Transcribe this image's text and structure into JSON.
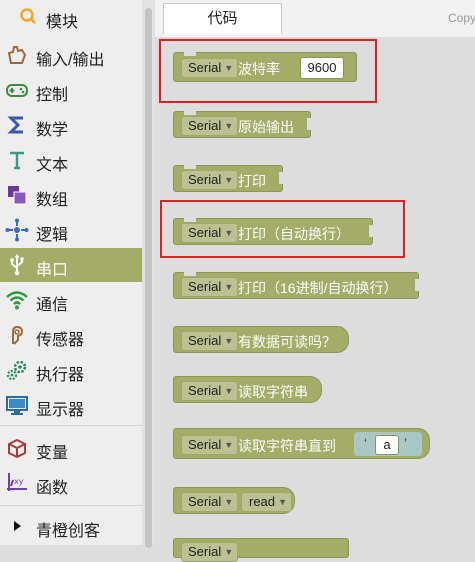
{
  "sidebar": {
    "header": "模块",
    "items": [
      {
        "label": "输入/输出",
        "icon": "hand-icon"
      },
      {
        "label": "控制",
        "icon": "gamepad-icon"
      },
      {
        "label": "数学",
        "icon": "sigma-icon"
      },
      {
        "label": "文本",
        "icon": "text-icon"
      },
      {
        "label": "数组",
        "icon": "array-icon"
      },
      {
        "label": "逻辑",
        "icon": "logic-icon"
      },
      {
        "label": "串口",
        "icon": "usb-icon"
      },
      {
        "label": "通信",
        "icon": "wifi-icon"
      },
      {
        "label": "传感器",
        "icon": "sensor-icon"
      },
      {
        "label": "执行器",
        "icon": "gears-icon"
      },
      {
        "label": "显示器",
        "icon": "monitor-icon"
      },
      {
        "label": "变量",
        "icon": "cube-icon"
      },
      {
        "label": "函数",
        "icon": "function-icon"
      },
      {
        "label": "青橙创客",
        "icon": "triangle-right-icon"
      }
    ],
    "active_index": 6
  },
  "tabs": {
    "code": "代码",
    "copy": "Copy"
  },
  "blocks": {
    "serial_label": "Serial",
    "begin_text": "波特率",
    "baud": "9600",
    "write_text": "原始输出",
    "print_text": "打印",
    "println_text": "打印（自动换行）",
    "print_hex_text": "打印（16进制/自动换行）",
    "available_text": "有数据可读吗？",
    "read_string_text": "读取字符串",
    "read_until_text": "读取字符串直到",
    "until_char": "a",
    "read_option": "read"
  },
  "colors": {
    "serial_block": "#a4ad68",
    "active_category": "#a4ad68",
    "highlight": "#e02020",
    "workspace": "#dddddd"
  }
}
